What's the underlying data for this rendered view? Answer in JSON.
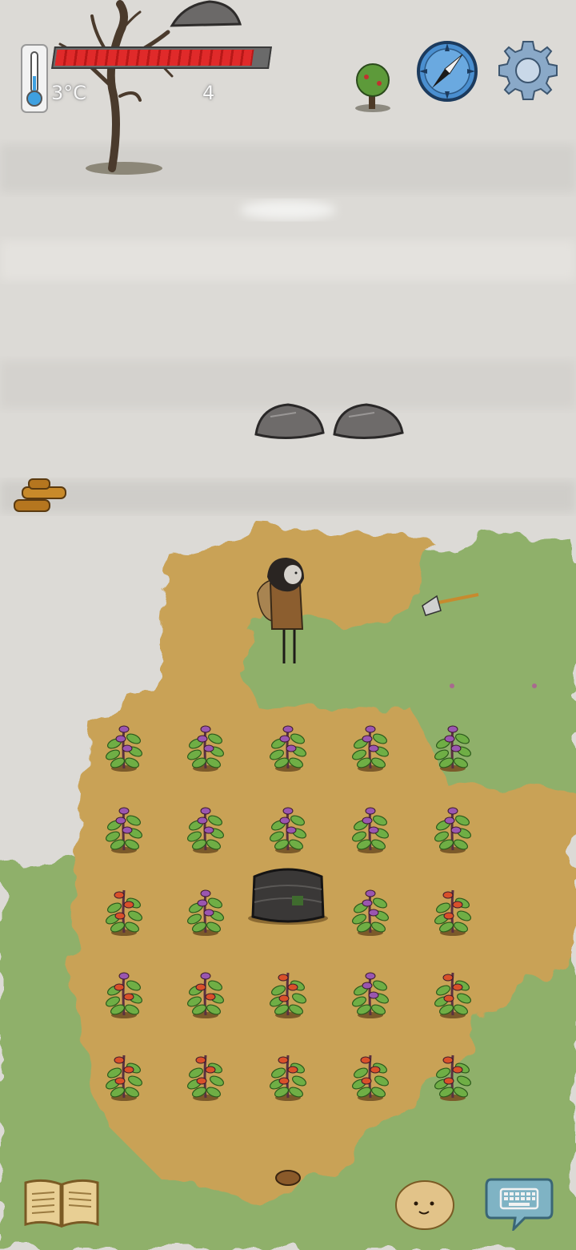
{
  "hud": {
    "temperature": "3°C",
    "health_fraction": 0.93,
    "counter": "4"
  },
  "colors": {
    "health": "#e02a2a",
    "grass": "#8fb06a",
    "soil": "#c9a256",
    "fog": "#dddad5",
    "compass": "#4a8fd0",
    "chat_bubble": "#7fb3c4"
  },
  "icons": {
    "thermometer": "thermometer-icon",
    "compass": "compass-icon",
    "settings": "gear-icon",
    "journal": "book-icon",
    "emote": "potato-face-icon",
    "chat": "keyboard-chat-icon"
  },
  "crops": {
    "rows": [
      [
        "purple",
        "purple",
        "purple",
        "purple",
        "purple"
      ],
      [
        "purple",
        "purple",
        "purple",
        "purple",
        "purple"
      ],
      [
        "red",
        "purple",
        "well",
        "purple",
        "red"
      ],
      [
        "mixed",
        "mixed",
        "red",
        "purple",
        "red"
      ],
      [
        "red",
        "red",
        "red",
        "red",
        "red"
      ]
    ]
  }
}
